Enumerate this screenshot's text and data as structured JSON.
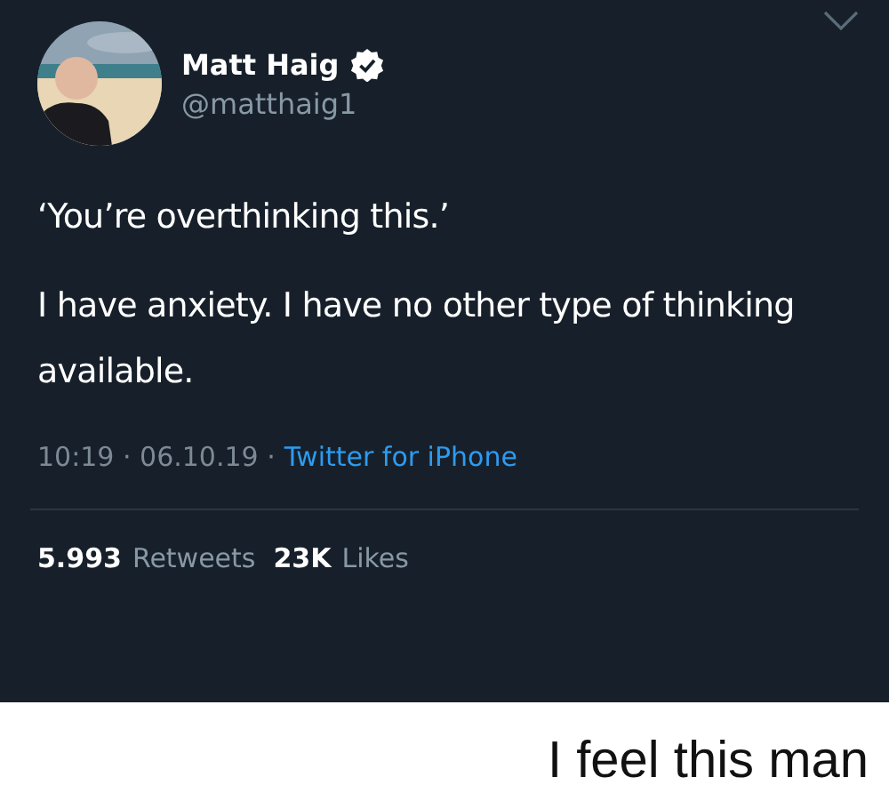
{
  "tweet": {
    "author": {
      "name": "Matt Haig",
      "verified": true,
      "handle": "@matthaig1"
    },
    "paragraphs": [
      "‘You’re overthinking this.’",
      "I have anxiety. I have no other type of thinking available."
    ],
    "timestamp": "10:19 · 06.10.19 ·",
    "source": "Twitter for iPhone",
    "stats": [
      {
        "count": "5.993",
        "label": "Retweets"
      },
      {
        "count": "23K",
        "label": "Likes"
      }
    ]
  },
  "caption": "I feel this man"
}
